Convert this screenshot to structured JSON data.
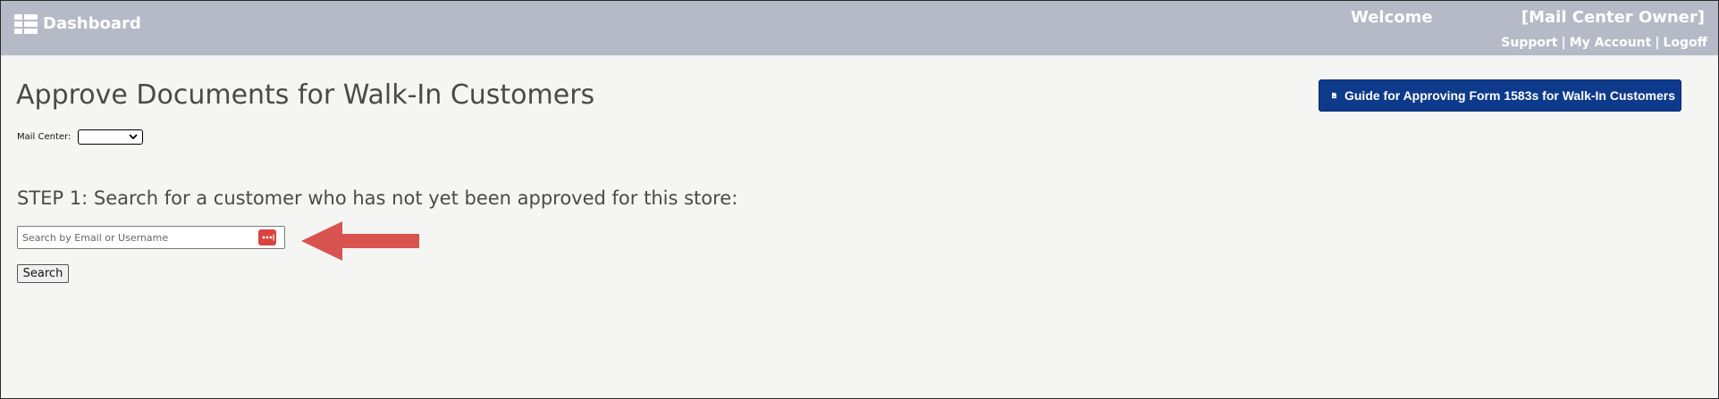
{
  "header": {
    "dashboard_label": "Dashboard",
    "welcome_label": "Welcome",
    "user_role": "[Mail Center Owner]",
    "links": {
      "support": "Support",
      "my_account": "My Account",
      "logoff": "Logoff"
    },
    "separator": "|",
    "icon": "dashboard-grid-icon"
  },
  "page": {
    "title": "Approve Documents for Walk-In Customers",
    "guide_button_label": "Guide for Approving Form 1583s for Walk-In Customers",
    "guide_button_icon": "pdf-file-icon",
    "mail_center_label": "Mail Center:",
    "mail_center_selected": ""
  },
  "step1": {
    "heading": "STEP 1: Search for a customer who has not yet been approved for this store:",
    "search_placeholder": "Search by Email or Username",
    "search_value": "",
    "password_manager_icon": "password-manager-icon",
    "search_button_label": "Search",
    "annotation": "red-arrow-pointing-left"
  },
  "colors": {
    "header_bg": "#b5bac6",
    "page_bg": "#f5f5f3",
    "guide_button_bg": "#0e3a8c",
    "arrow": "#d9534f",
    "password_icon_bg": "#d9443f"
  }
}
